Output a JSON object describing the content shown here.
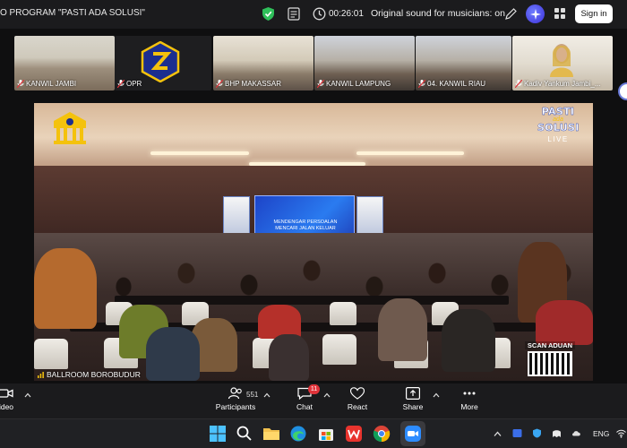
{
  "titlebar": {
    "meeting_title": "O PROGRAM \"PASTI ADA SOLUSI\"",
    "timer": "00:26:01",
    "audio_status": "Original sound for musicians: on",
    "signin_label": "Sign in"
  },
  "participants_strip": [
    {
      "name": "KANWIL JAMBI"
    },
    {
      "name": "OPR"
    },
    {
      "name": "BHP MAKASSAR"
    },
    {
      "name": "KANWIL LAMPUNG"
    },
    {
      "name": "04. KANWIL RIAU"
    },
    {
      "name": "Kadiv Yankum Jambi_..."
    }
  ],
  "main_video": {
    "room_name": "BALLROOM BOROBUDUR",
    "overlay_brand_top": "PASTI",
    "overlay_brand_mid": "ada",
    "overlay_brand_bottom": "SOLUSI",
    "overlay_live": "LIVE",
    "stage_headline_1": "MENDENGAR PERSOALAN",
    "stage_headline_2": "MENCARI JALAN KELUAR",
    "scan_label": "SCAN ADUAN"
  },
  "toolbar": {
    "video_label": "ideo",
    "participants_label": "Participants",
    "participants_count": "551",
    "chat_label": "Chat",
    "chat_badge": "11",
    "react_label": "React",
    "share_label": "Share",
    "more_label": "More"
  },
  "taskbar": {
    "language": "ENG"
  },
  "colors": {
    "accent": "#3c2fd8",
    "chat_badge": "#e0333a",
    "stage_blue": "#2a7bf0"
  }
}
